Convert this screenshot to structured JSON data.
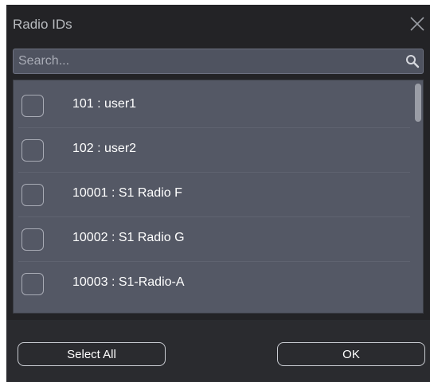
{
  "dialog": {
    "title": "Radio IDs"
  },
  "search": {
    "placeholder": "Search..."
  },
  "list": {
    "items": [
      {
        "label": "101 : user1",
        "checked": false
      },
      {
        "label": "102 : user2",
        "checked": false
      },
      {
        "label": "10001 : S1 Radio F",
        "checked": false
      },
      {
        "label": "10002 : S1 Radio G",
        "checked": false
      },
      {
        "label": "10003 : S1-Radio-A",
        "checked": false
      }
    ]
  },
  "buttons": {
    "select_all": "Select All",
    "ok": "OK"
  },
  "icons": {
    "close": "close-icon",
    "search": "search-icon"
  },
  "colors": {
    "dialog_bg": "#232326",
    "list_bg": "#545865",
    "text": "#ffffff"
  }
}
